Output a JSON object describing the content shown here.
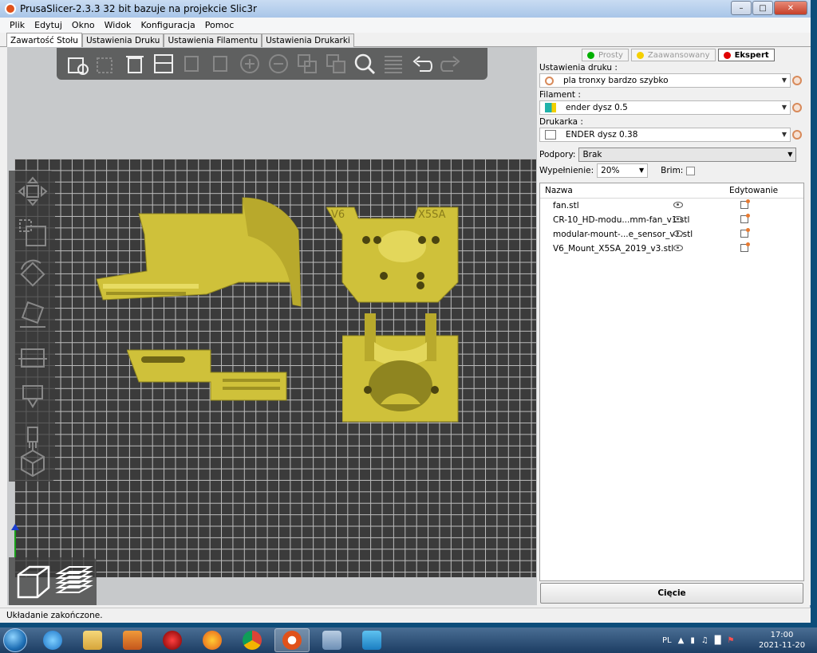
{
  "window": {
    "title": "PrusaSlicer-2.3.3 32 bit bazuje na projekcie Slic3r",
    "controls": [
      "minimize",
      "maximize",
      "close"
    ]
  },
  "menu": {
    "items": [
      "Plik",
      "Edytuj",
      "Okno",
      "Widok",
      "Konfiguracja",
      "Pomoc"
    ]
  },
  "tabs": {
    "items": [
      "Zawartość Stołu",
      "Ustawienia Druku",
      "Ustawienia Filamentu",
      "Ustawienia Drukarki"
    ],
    "active": "Zawartość Stołu"
  },
  "toolbar": {
    "icons": [
      "add-icon",
      "delete-icon",
      "delete-all-icon",
      "arrange-icon",
      "copy-icon",
      "paste-icon",
      "add-instance-icon",
      "remove-instance-icon",
      "split-objects-icon",
      "split-parts-icon",
      "search-icon",
      "layers-editing-icon",
      "undo-icon",
      "redo-icon"
    ]
  },
  "side_tools": {
    "icons": [
      "move-icon",
      "scale-icon",
      "rotate-icon",
      "place-on-face-icon",
      "cut-icon",
      "paint-supports-icon",
      "seam-painting-icon",
      "hollow-icon"
    ]
  },
  "view_toggle": {
    "icons": [
      "3d-view-icon",
      "preview-icon"
    ]
  },
  "mode": {
    "simple": "Prosty",
    "advanced": "Zaawansowany",
    "expert": "Ekspert",
    "colors": {
      "simple": "#00b000",
      "advanced": "#f5d000",
      "expert": "#e00000"
    }
  },
  "settings": {
    "print_label": "Ustawienia druku :",
    "print_value": "pla tronxy bardzo szybko",
    "filament_label": "Filament :",
    "filament_value": "ender dysz 0.5",
    "printer_label": "Drukarka :",
    "printer_value": "ENDER dysz 0.38",
    "supports_label": "Podpory:",
    "supports_value": "Brak",
    "infill_label": "Wypełnienie:",
    "infill_value": "20%",
    "brim_label": "Brim:",
    "brim_checked": false
  },
  "objects": {
    "col_name": "Nazwa",
    "col_edit": "Edytowanie",
    "rows": [
      {
        "name": "fan.stl"
      },
      {
        "name": "CR-10_HD-modu...mm-fan_v1.stl"
      },
      {
        "name": "modular-mount-...e_sensor_v1.stl"
      },
      {
        "name": "V6_Mount_X5SA_2019_v3.stl"
      }
    ]
  },
  "slice_button": "Cięcie",
  "status": "Układanie zakończone.",
  "taskbar": {
    "apps": [
      "internet-explorer-icon",
      "file-explorer-icon",
      "media-player-icon",
      "app-icon",
      "firefox-icon",
      "chrome-icon",
      "prusaslicer-icon",
      "calculator-icon",
      "mail-icon"
    ],
    "lang": "PL",
    "time": "17:00",
    "date": "2021-11-20"
  },
  "parts_on_bed": {
    "labels": [
      "V6",
      "X5SA"
    ],
    "color": "#cfc13a"
  }
}
